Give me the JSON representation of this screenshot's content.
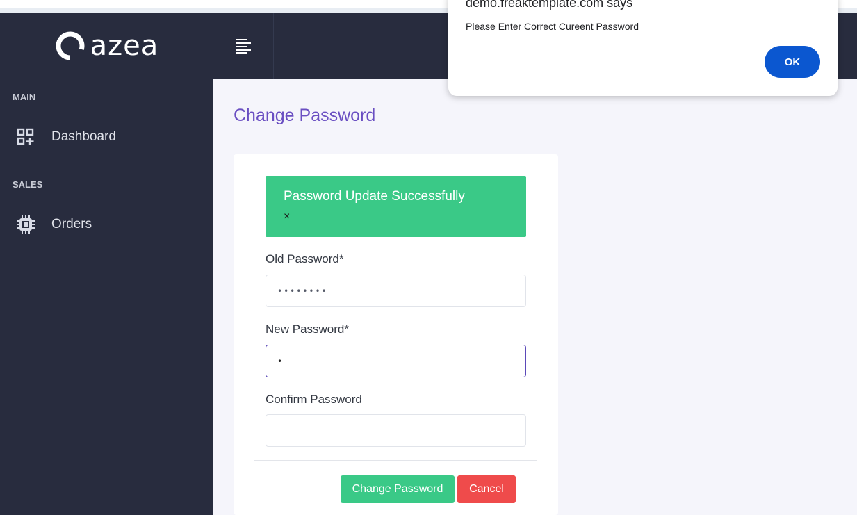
{
  "brand": {
    "logo_text": "azea"
  },
  "sidebar": {
    "sections": [
      {
        "label": "MAIN"
      },
      {
        "label": "SALES"
      }
    ],
    "items": [
      {
        "label": "Dashboard",
        "icon": "dashboard-icon"
      },
      {
        "label": "Orders",
        "icon": "chip-icon"
      }
    ]
  },
  "header": {
    "menu_icon": "menu-lines-icon"
  },
  "page": {
    "title": "Change Password"
  },
  "alert": {
    "text": "Password Update Successfully",
    "close": "×",
    "color": "#3ac987"
  },
  "form": {
    "old_password": {
      "label": "Old Password*",
      "value": "••••••••"
    },
    "new_password": {
      "label": "New Password*",
      "value": "•"
    },
    "confirm_password": {
      "label": "Confirm Password",
      "value": ""
    },
    "submit_label": "Change Password",
    "cancel_label": "Cancel"
  },
  "dialog": {
    "title": "demo.freaktemplate.com says",
    "message": "Please Enter Correct Cureent Password",
    "ok_label": "OK"
  },
  "colors": {
    "sidebar_bg": "#282c3e",
    "accent_purple": "#6a4fc2",
    "success_green": "#3ac987",
    "danger_red": "#ef4b4b",
    "dialog_button": "#0b57d0"
  }
}
